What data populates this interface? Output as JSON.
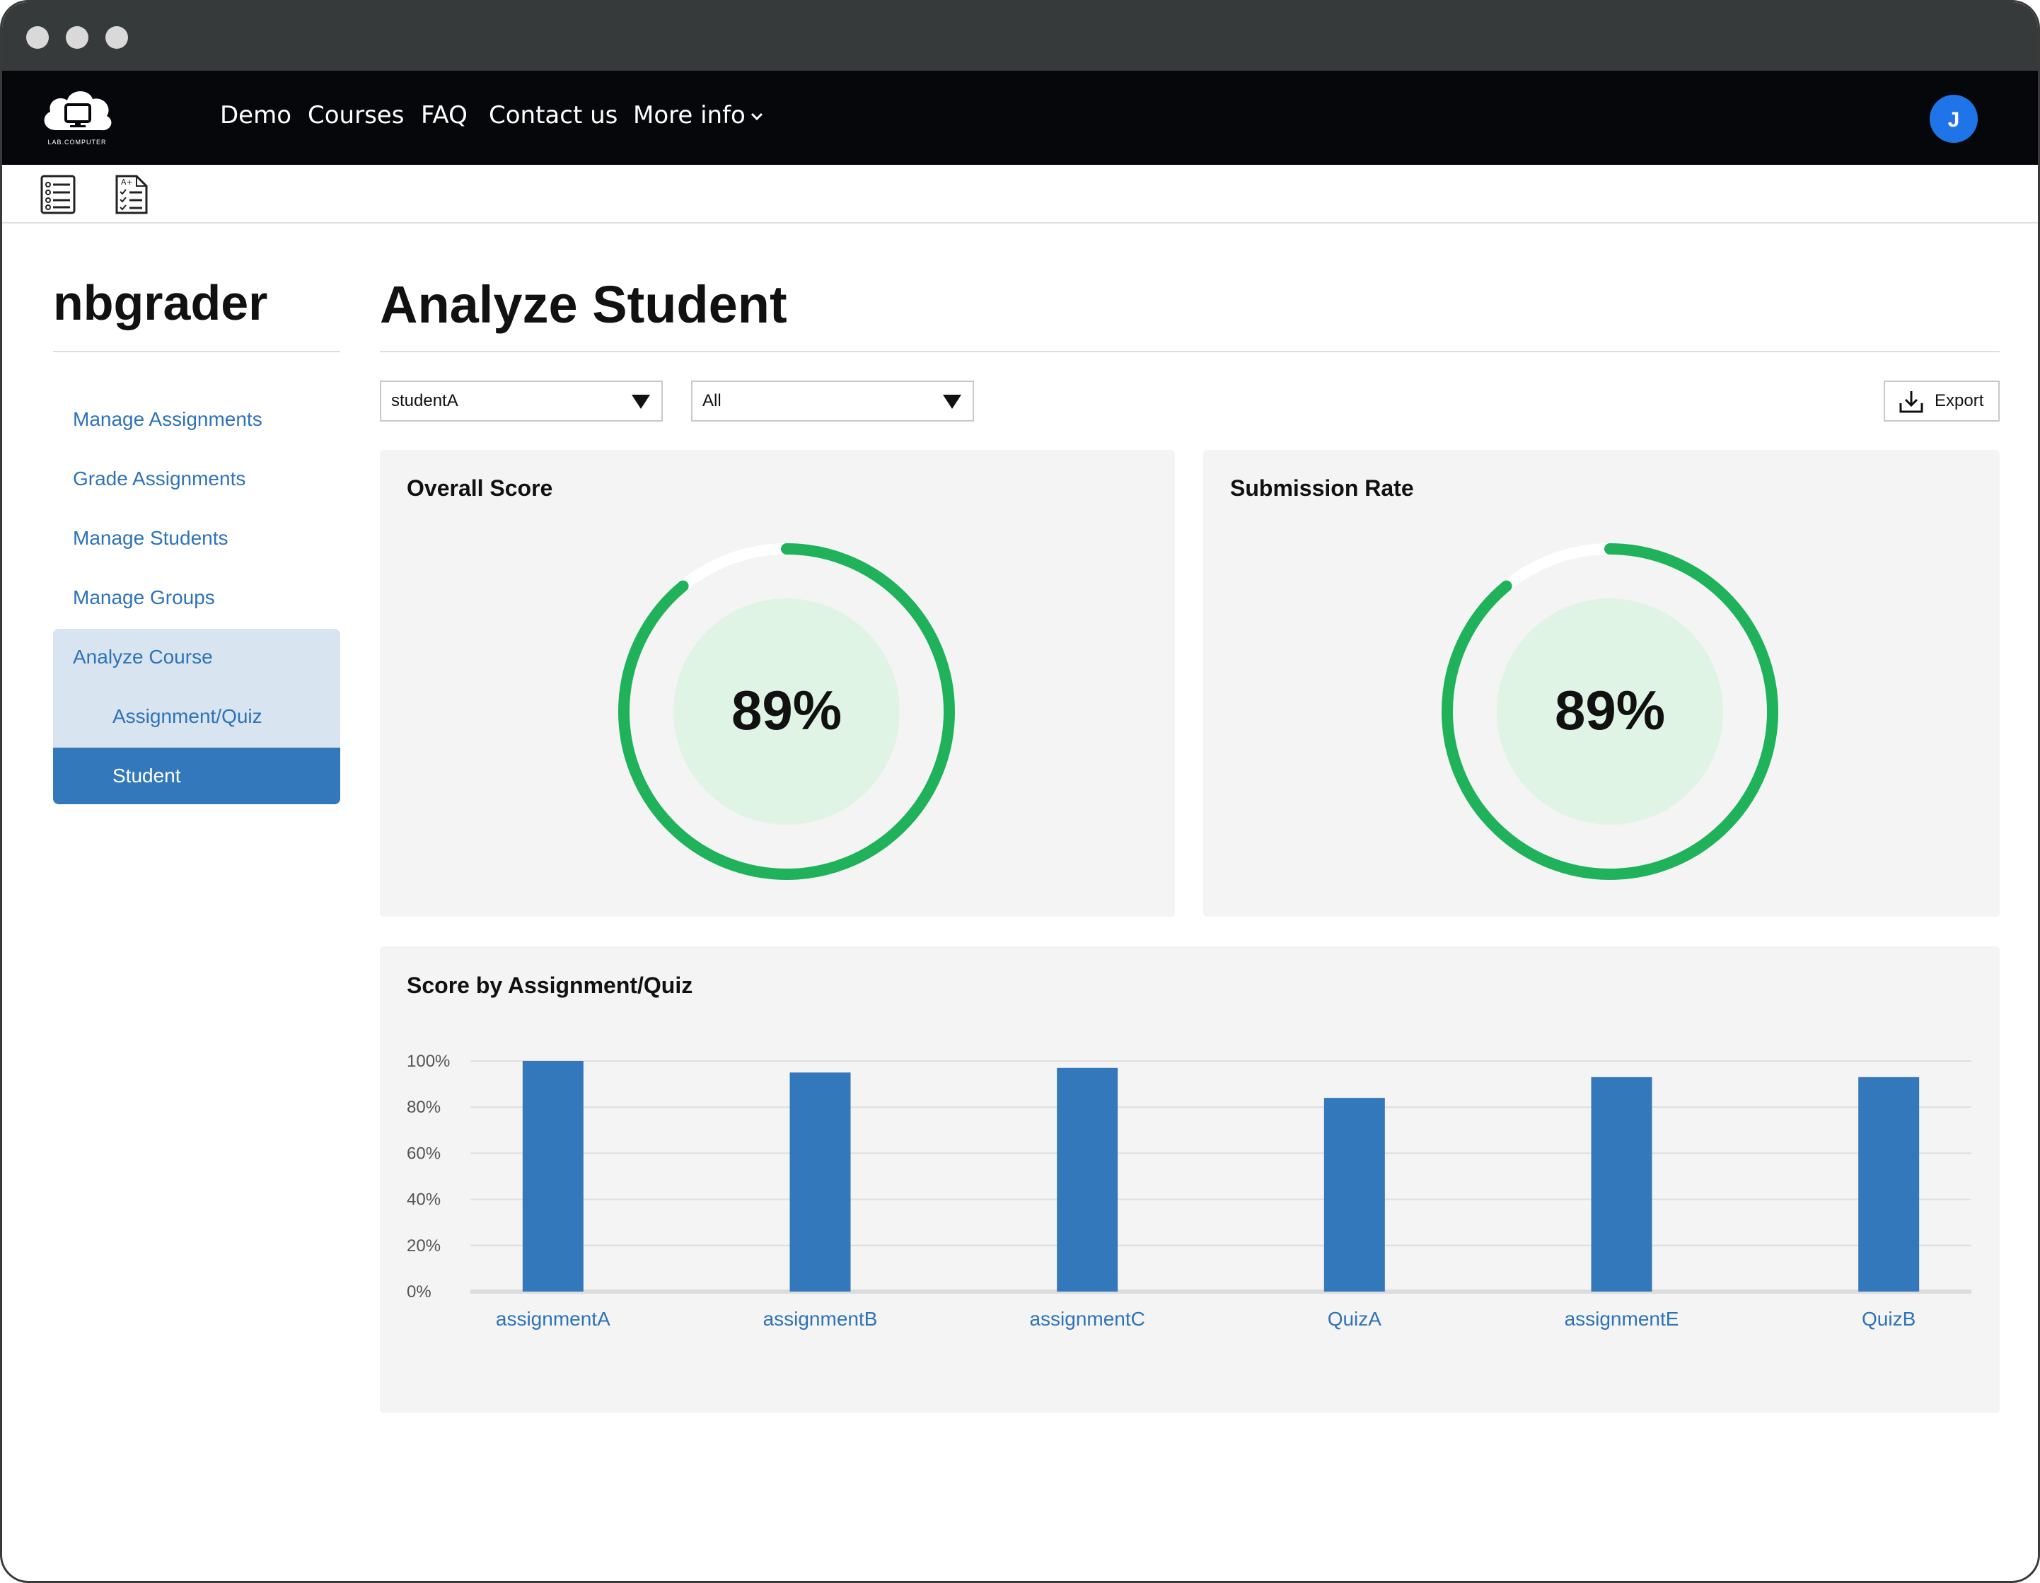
{
  "navbar": {
    "logo_text": "LAB.COMPUTER",
    "items": [
      "Demo",
      "Courses",
      "FAQ",
      "Contact us",
      "More info"
    ],
    "avatar_initial": "J"
  },
  "toolbar": {
    "icons": [
      "list-icon",
      "checklist-icon"
    ]
  },
  "sidebar": {
    "title": "nbgrader",
    "items": [
      "Manage Assignments",
      "Grade Assignments",
      "Manage Students",
      "Manage Groups",
      "Analyze Course"
    ],
    "subitems": [
      "Assignment/Quiz",
      "Student"
    ],
    "active": "Student"
  },
  "main": {
    "title": "Analyze Student",
    "student_select": "studentA",
    "filter_select": "All",
    "export_label": "Export"
  },
  "cards": {
    "overall": {
      "title": "Overall Score",
      "value_label": "89%",
      "value": 0.89
    },
    "submission": {
      "title": "Submission Rate",
      "value_label": "89%",
      "value": 0.89
    }
  },
  "colors": {
    "accent_blue": "#3478bc",
    "link_blue": "#2e73b8",
    "ring_green": "#1fb25a",
    "ring_fill": "#dff4e5",
    "avatar_blue": "#1f74e8"
  },
  "chart_data": {
    "type": "bar",
    "title": "Score by Assignment/Quiz",
    "categories": [
      "assignmentA",
      "assignmentB",
      "assignmentC",
      "QuizA",
      "assignmentE",
      "QuizB"
    ],
    "values": [
      100,
      95,
      97,
      84,
      93,
      93
    ],
    "ylim": [
      0,
      100
    ],
    "yticks": [
      "0%",
      "20%",
      "40%",
      "60%",
      "80%",
      "100%"
    ],
    "xlabel": "",
    "ylabel": "",
    "grid": true,
    "color": "#3478bc"
  }
}
